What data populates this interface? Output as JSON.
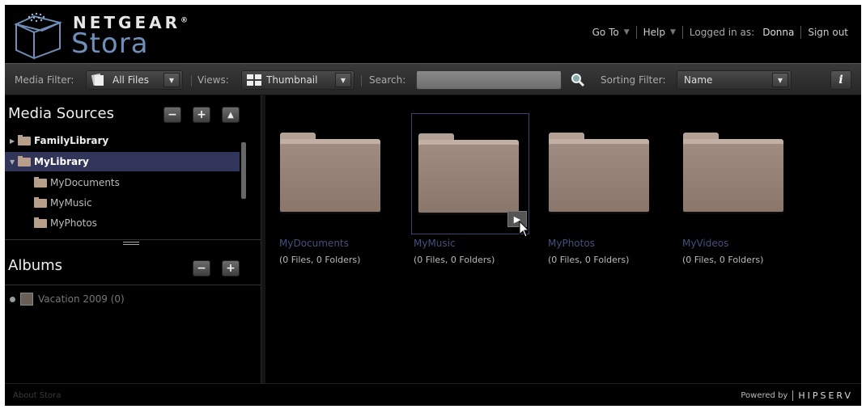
{
  "header": {
    "brand": "NETGEAR",
    "brand_mark": "®",
    "product": "Stora",
    "nav": {
      "goto_label": "Go To",
      "help_label": "Help",
      "logged_in_label": "Logged in as:",
      "username": "Donna",
      "signout_label": "Sign out"
    }
  },
  "toolbar": {
    "media_filter_label": "Media Filter:",
    "media_filter_value": "All Files",
    "views_label": "Views:",
    "views_value": "Thumbnail",
    "search_label": "Search:",
    "search_value": "",
    "sorting_filter_label": "Sorting Filter:",
    "sorting_filter_value": "Name",
    "info_label": "i"
  },
  "media_sources": {
    "title": "Media Sources",
    "items": [
      {
        "label": "FamilyLibrary",
        "expanded": false,
        "selected": false,
        "level": 0
      },
      {
        "label": "MyLibrary",
        "expanded": true,
        "selected": true,
        "level": 0
      },
      {
        "label": "MyDocuments",
        "level": 1
      },
      {
        "label": "MyMusic",
        "level": 1
      },
      {
        "label": "MyPhotos",
        "level": 1
      }
    ]
  },
  "albums": {
    "title": "Albums",
    "items": [
      {
        "label": "Vacation 2009 (0)"
      }
    ]
  },
  "main": {
    "folders": [
      {
        "name": "MyDocuments",
        "info": "(0 Files, 0 Folders)"
      },
      {
        "name": "MyMusic",
        "info": "(0 Files, 0 Folders)",
        "selected": true
      },
      {
        "name": "MyPhotos",
        "info": "(0 Files, 0 Folders)"
      },
      {
        "name": "MyVideos",
        "info": "(0 Files, 0 Folders)"
      }
    ]
  },
  "footer": {
    "about_label": "About Stora",
    "powered_label": "Powered by",
    "powered_brand": "HIPSERV"
  },
  "colors": {
    "background": "#000000",
    "selection": "#32355a",
    "folder_name": "#43507e",
    "folder_body": "#9f8b7f",
    "stora_blue": "#6f8fb8"
  },
  "icons": {
    "logo": "netgear-cube-icon",
    "search": "magnifier-icon",
    "media_filter": "files-icon",
    "views": "grid-icon",
    "play": "play-icon"
  }
}
